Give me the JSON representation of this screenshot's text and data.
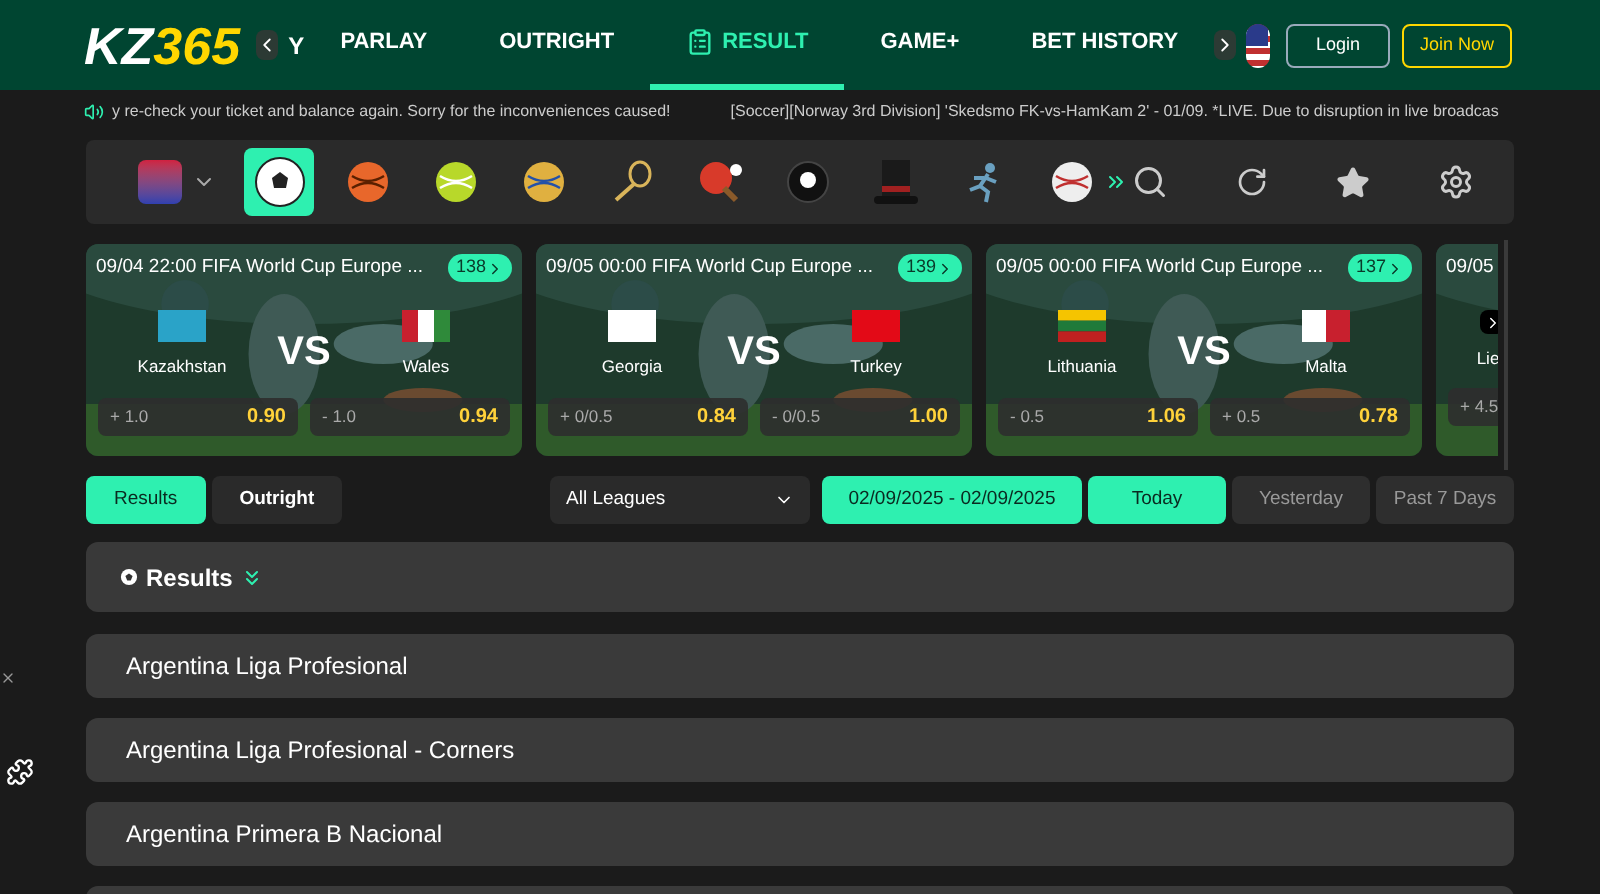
{
  "logo": {
    "part_1": "KZ",
    "part_2": "365"
  },
  "nav": {
    "cut_item": "Y",
    "items": [
      {
        "label": "PARLAY",
        "selected": false
      },
      {
        "label": "OUTRIGHT",
        "selected": false
      },
      {
        "label": "RESULT",
        "selected": true
      },
      {
        "label": "GAME+",
        "selected": false
      },
      {
        "label": "BET HISTORY",
        "selected": false
      }
    ]
  },
  "account": {
    "login": "Login",
    "join": "Join Now"
  },
  "ticker": [
    "y re-check your ticket and balance again. Sorry for the inconveniences caused!",
    "[Soccer][Norway 3rd Division] 'Skedsmo FK-vs-HamKam 2' - 01/09. *LIVE. Due to disruption in live broadcas"
  ],
  "sports": [
    {
      "selected": true
    },
    {
      "selected": false
    },
    {
      "selected": false
    },
    {
      "selected": false
    },
    {
      "selected": false
    },
    {
      "selected": false
    },
    {
      "selected": false
    },
    {
      "selected": false
    },
    {
      "selected": false
    },
    {
      "selected": false
    }
  ],
  "matches": [
    {
      "time": "09/04 22:00",
      "league": "FIFA World Cup Europe ...",
      "count": "138",
      "home": "Kazakhstan",
      "away": "Wales",
      "vs": "VS",
      "home_line": "+ 1.0",
      "home_odds": "0.90",
      "away_line": "- 1.0",
      "away_odds": "0.94"
    },
    {
      "time": "09/05 00:00",
      "league": "FIFA World Cup Europe ...",
      "count": "139",
      "home": "Georgia",
      "away": "Turkey",
      "vs": "VS",
      "home_line": "+ 0/0.5",
      "home_odds": "0.84",
      "away_line": "- 0/0.5",
      "away_odds": "1.00"
    },
    {
      "time": "09/05 00:00",
      "league": "FIFA World Cup Europe ...",
      "count": "137",
      "home": "Lithuania",
      "away": "Malta",
      "vs": "VS",
      "home_line": "- 0.5",
      "home_odds": "1.06",
      "away_line": "+ 0.5",
      "away_odds": "0.78"
    },
    {
      "time": "09/05",
      "home": "Lie",
      "home_line": "+ 4.5"
    }
  ],
  "filter_tabs": [
    {
      "label": "Results",
      "selected": true
    },
    {
      "label": "Outright",
      "selected": false
    }
  ],
  "league_select": "All Leagues",
  "date_range": "02/09/2025 - 02/09/2025",
  "periods": [
    {
      "label": "Today",
      "selected": true
    },
    {
      "label": "Yesterday",
      "selected": false
    },
    {
      "label": "Past 7 Days",
      "selected": false
    }
  ],
  "results_title": "Results",
  "leagues": [
    "Argentina Liga Profesional",
    "Argentina Liga Profesional - Corners",
    "Argentina Primera B Nacional"
  ]
}
